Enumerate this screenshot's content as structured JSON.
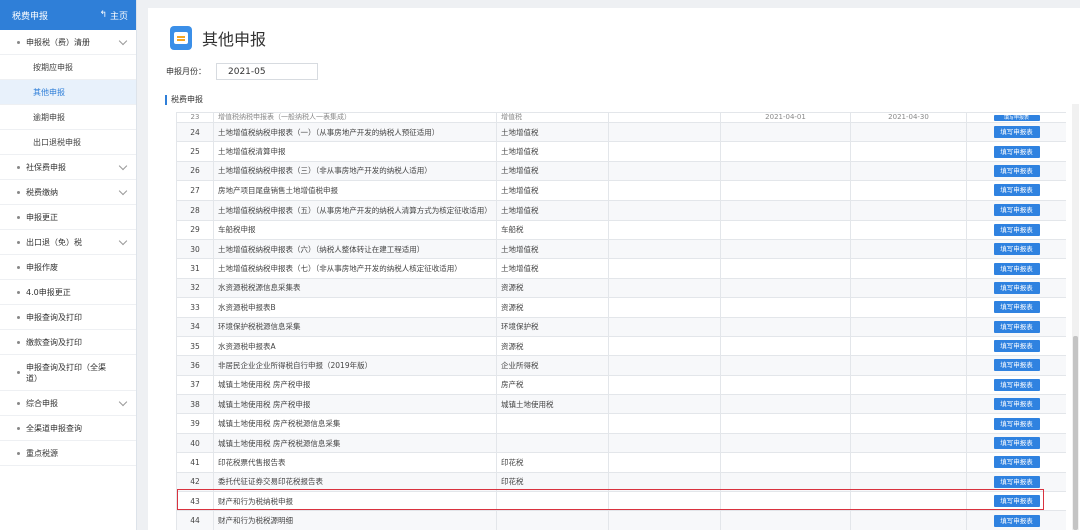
{
  "sidebar": {
    "title": "税费申报",
    "home": "主页",
    "items": [
      {
        "label": "申报税（费）清册",
        "expandable": true
      },
      {
        "label": "按期应申报"
      },
      {
        "label": "其他申报",
        "active": true
      },
      {
        "label": "逾期申报"
      },
      {
        "label": "出口退税申报"
      },
      {
        "label": "社保费申报",
        "expandable": true
      },
      {
        "label": "税费缴纳",
        "expandable": true
      },
      {
        "label": "申报更正"
      },
      {
        "label": "出口退（免）税",
        "expandable": true
      },
      {
        "label": "申报作废"
      },
      {
        "label": "4.0申报更正"
      },
      {
        "label": "申报查询及打印"
      },
      {
        "label": "缴款查询及打印"
      },
      {
        "label": "申报查询及打印（全渠道）"
      },
      {
        "label": "综合申报",
        "expandable": true
      },
      {
        "label": "全渠道申报查询"
      },
      {
        "label": "重点税源"
      }
    ]
  },
  "main": {
    "title": "其他申报",
    "month_label": "申报月份：",
    "month_value": "2021-05",
    "section_label": "税费申报",
    "button_label": "填写申报表",
    "partial_row": {
      "no": "23",
      "name": "增值税纳税申报表（一般纳税人一表集成）",
      "tax": "增值税",
      "start": "2021-04-01",
      "end": "2021-04-30"
    },
    "rows": [
      {
        "no": "24",
        "name": "土地增值税纳税申报表（一）（从事房地产开发的纳税人预征适用）",
        "tax": "土地增值税"
      },
      {
        "no": "25",
        "name": "土地增值税清算申报",
        "tax": "土地增值税"
      },
      {
        "no": "26",
        "name": "土地增值税纳税申报表（三）（非从事房地产开发的纳税人适用）",
        "tax": "土地增值税"
      },
      {
        "no": "27",
        "name": "房地产项目尾盘销售土地增值税申报",
        "tax": "土地增值税"
      },
      {
        "no": "28",
        "name": "土地增值税纳税申报表（五）（从事房地产开发的纳税人清算方式为核定征收适用）",
        "tax": "土地增值税",
        "tall": true
      },
      {
        "no": "29",
        "name": "车船税申报",
        "tax": "车船税"
      },
      {
        "no": "30",
        "name": "土地增值税纳税申报表（六）（纳税人整体转让在建工程适用）",
        "tax": "土地增值税"
      },
      {
        "no": "31",
        "name": "土地增值税纳税申报表（七）（非从事房地产开发的纳税人核定征收适用）",
        "tax": "土地增值税"
      },
      {
        "no": "32",
        "name": "水资源税税源信息采集表",
        "tax": "资源税"
      },
      {
        "no": "33",
        "name": "水资源税申报表B",
        "tax": "资源税"
      },
      {
        "no": "34",
        "name": "环境保护税税源信息采集",
        "tax": "环境保护税"
      },
      {
        "no": "35",
        "name": "水资源税申报表A",
        "tax": "资源税"
      },
      {
        "no": "36",
        "name": "非居民企业企业所得税自行申报（2019年版）",
        "tax": "企业所得税"
      },
      {
        "no": "37",
        "name": "城镇土地使用税 房产税申报",
        "tax": "房产税"
      },
      {
        "no": "38",
        "name": "城镇土地使用税 房产税申报",
        "tax": "城镇土地使用税"
      },
      {
        "no": "39",
        "name": "城镇土地使用税 房产税税源信息采集",
        "tax": ""
      },
      {
        "no": "40",
        "name": "城镇土地使用税 房产税税源信息采集",
        "tax": ""
      },
      {
        "no": "41",
        "name": "印花税票代售报告表",
        "tax": "印花税"
      },
      {
        "no": "42",
        "name": "委托代征证券交易印花税报告表",
        "tax": "印花税"
      },
      {
        "no": "43",
        "name": "财产和行为税纳税申报",
        "tax": ""
      },
      {
        "no": "44",
        "name": "财产和行为税税源明细",
        "tax": ""
      }
    ]
  },
  "colors": {
    "primary": "#2f7fd8",
    "highlight": "#d9333f"
  }
}
